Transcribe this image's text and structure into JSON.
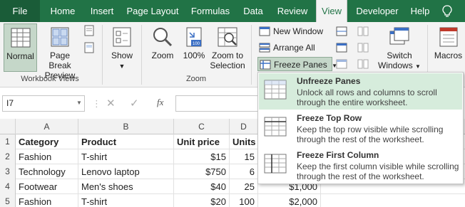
{
  "tabs": [
    "File",
    "Home",
    "Insert",
    "Page Layout",
    "Formulas",
    "Data",
    "Review",
    "View",
    "Developer",
    "Help"
  ],
  "ribbon": {
    "normal": "Normal",
    "page_break_1": "Page Break",
    "page_break_2": "Preview",
    "show": "Show",
    "zoom": "Zoom",
    "zoom100": "100%",
    "zoom_sel_1": "Zoom to",
    "zoom_sel_2": "Selection",
    "new_window": "New Window",
    "arrange_all": "Arrange All",
    "freeze_panes": "Freeze Panes",
    "switch_1": "Switch",
    "switch_2": "Windows",
    "macros": "Macros",
    "group_workbook_views": "Workbook Views",
    "group_zoom": "Zoom"
  },
  "formula_bar": {
    "name_box": "I7",
    "fx": "fx"
  },
  "columns": [
    "A",
    "B",
    "C",
    "D"
  ],
  "rows": [
    {
      "n": "1",
      "a": "Category",
      "b": "Product",
      "c": "Unit price",
      "d": "Units"
    },
    {
      "n": "2",
      "a": "Fashion",
      "b": "T-shirt",
      "c": "$15",
      "d": "15"
    },
    {
      "n": "3",
      "a": "Technology",
      "b": "Lenovo laptop",
      "c": "$750",
      "d": "6"
    },
    {
      "n": "4",
      "a": "Footwear",
      "b": "Men's shoes",
      "c": "$40",
      "d": "25",
      "e": "$1,000"
    },
    {
      "n": "5",
      "a": "Fashion",
      "b": "T-shirt",
      "c": "$20",
      "d": "100",
      "e": "$2,000"
    }
  ],
  "menu": [
    {
      "title": "Unfreeze Panes",
      "desc": "Unlock all rows and columns to scroll through the entire worksheet."
    },
    {
      "title": "Freeze Top Row",
      "desc": "Keep the top row visible while scrolling through the rest of the worksheet."
    },
    {
      "title": "Freeze First Column",
      "desc": "Keep the first column visible while scrolling through the rest of the worksheet."
    }
  ],
  "colors": {
    "excel_green": "#217346",
    "highlight": "#d6ecdc"
  }
}
